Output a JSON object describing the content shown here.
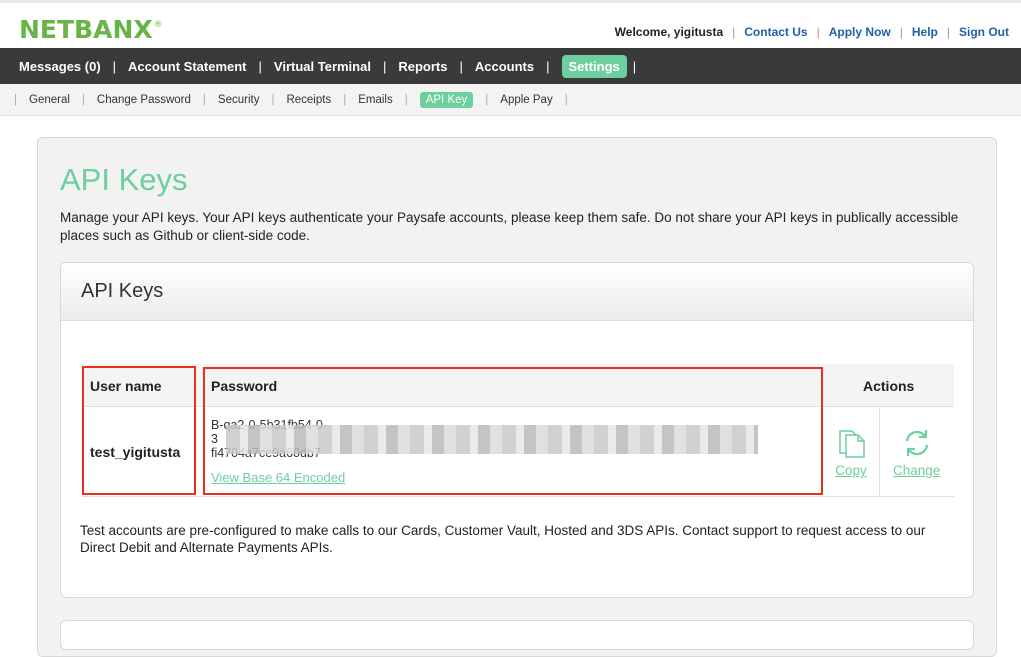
{
  "brand": {
    "logo_text": "NETBANX",
    "logo_mark": "®"
  },
  "top_links": {
    "welcome": "Welcome, yigitusta",
    "links": [
      "Contact Us",
      "Apply Now",
      "Help",
      "Sign Out"
    ]
  },
  "main_nav": {
    "items": [
      "Messages (0)",
      "Account Statement",
      "Virtual Terminal",
      "Reports",
      "Accounts",
      "Settings"
    ],
    "active": "Settings"
  },
  "sub_nav": {
    "items": [
      "General",
      "Change Password",
      "Security",
      "Receipts",
      "Emails",
      "API Key",
      "Apple Pay"
    ],
    "active": "API Key"
  },
  "page": {
    "title": "API Keys",
    "description": "Manage your API keys. Your API keys authenticate your Paysafe accounts, please keep them safe. Do not share your API keys in publically accessible places such as Github or client-side code."
  },
  "panel": {
    "title": "API Keys",
    "table": {
      "headers": {
        "user": "User name",
        "password": "Password",
        "actions": "Actions"
      },
      "row": {
        "user_name": "test_yigitusta",
        "password_line1": "B-qa2-0-5b31fb54-0-",
        "password_line2": "3",
        "password_line3": "fi4704a7ce9a60db7",
        "base64_link": "View Base 64 Encoded",
        "actions": {
          "copy": "Copy",
          "change": "Change"
        }
      }
    },
    "note": "Test accounts are pre-configured to make calls to our Cards, Customer Vault, Hosted and 3DS APIs. Contact support to request access to our Direct Debit and Alternate Payments APIs."
  },
  "colors": {
    "accent": "#6ccf9d",
    "logo": "#68b447",
    "nav_bg": "#3a3a3a",
    "highlight": "#e8331c",
    "link": "#1f5fa8"
  }
}
